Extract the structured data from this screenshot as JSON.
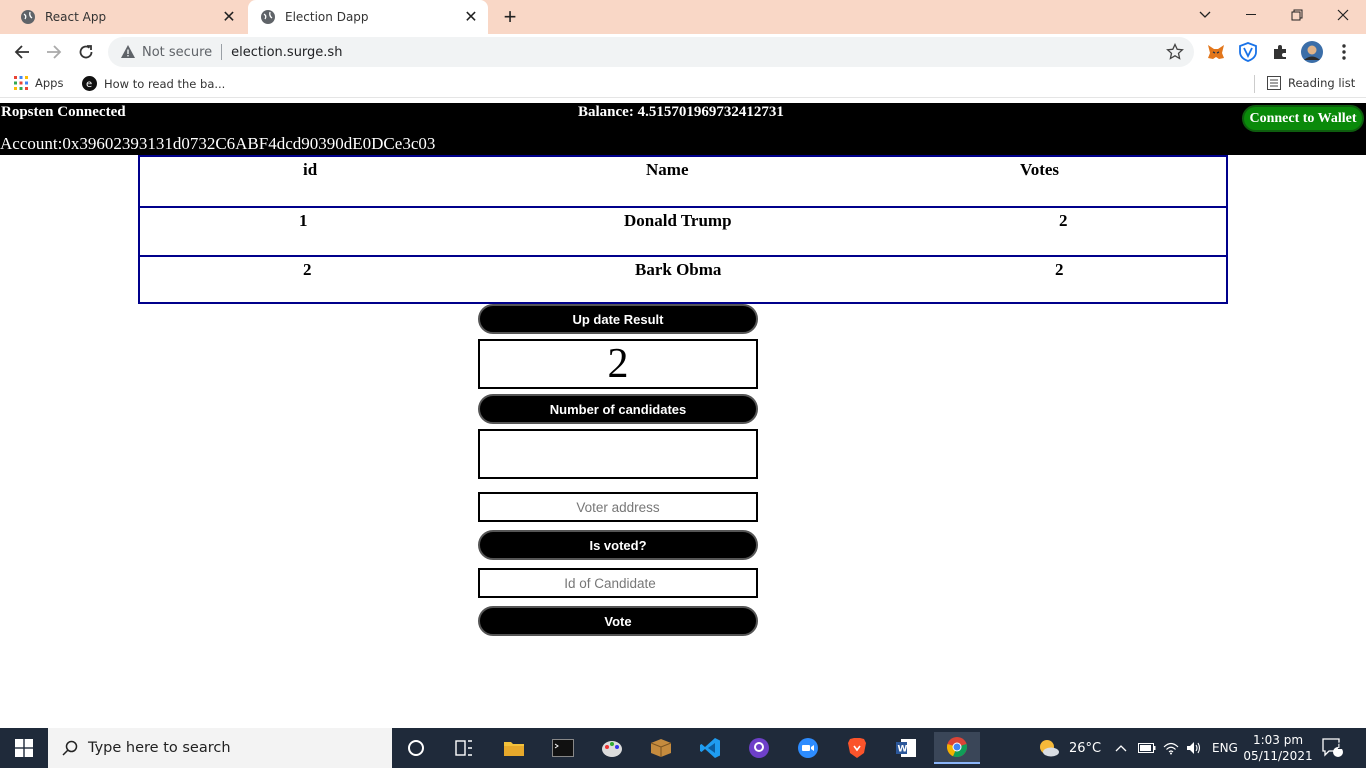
{
  "browser": {
    "tabs": [
      {
        "title": "React App",
        "active": false
      },
      {
        "title": "Election Dapp",
        "active": true
      }
    ],
    "address": {
      "security": "Not secure",
      "url": "election.surge.sh"
    },
    "bookmarks": [
      {
        "label": "Apps"
      },
      {
        "label": "How to read the ba..."
      }
    ],
    "reading_list": "Reading list"
  },
  "app": {
    "network_status": "Ropsten Connected",
    "balance": "Balance: 4.515701969732412731",
    "account": "Account:0x39602393131d0732C6ABF4dcd90390dE0DCe3c03",
    "connect_button": "Connect to Wallet",
    "table": {
      "headers": [
        "id",
        "Name",
        "Votes"
      ],
      "rows": [
        {
          "id": "1",
          "name": "Donald Trump",
          "votes": "2"
        },
        {
          "id": "2",
          "name": "Bark Obma",
          "votes": "2"
        }
      ]
    },
    "update_result_button": "Up date Result",
    "candidate_count": "2",
    "number_of_candidates_button": "Number of candidates",
    "candidates_number_value": "",
    "voter_address_placeholder": "Voter address",
    "is_voted_button": "Is voted?",
    "candidate_id_placeholder": "Id of Candidate",
    "vote_button": "Vote"
  },
  "taskbar": {
    "search_placeholder": "Type here to search",
    "weather": "26°C",
    "language": "ENG",
    "time": "1:03 pm",
    "date": "05/11/2021",
    "notification_count": "1"
  },
  "colors": {
    "tabstrip": "#f9d7c6",
    "header_bg": "#000000",
    "connect_green": "#0a8a0a",
    "table_border": "#00008b",
    "taskbar": "#1f2a3a"
  }
}
